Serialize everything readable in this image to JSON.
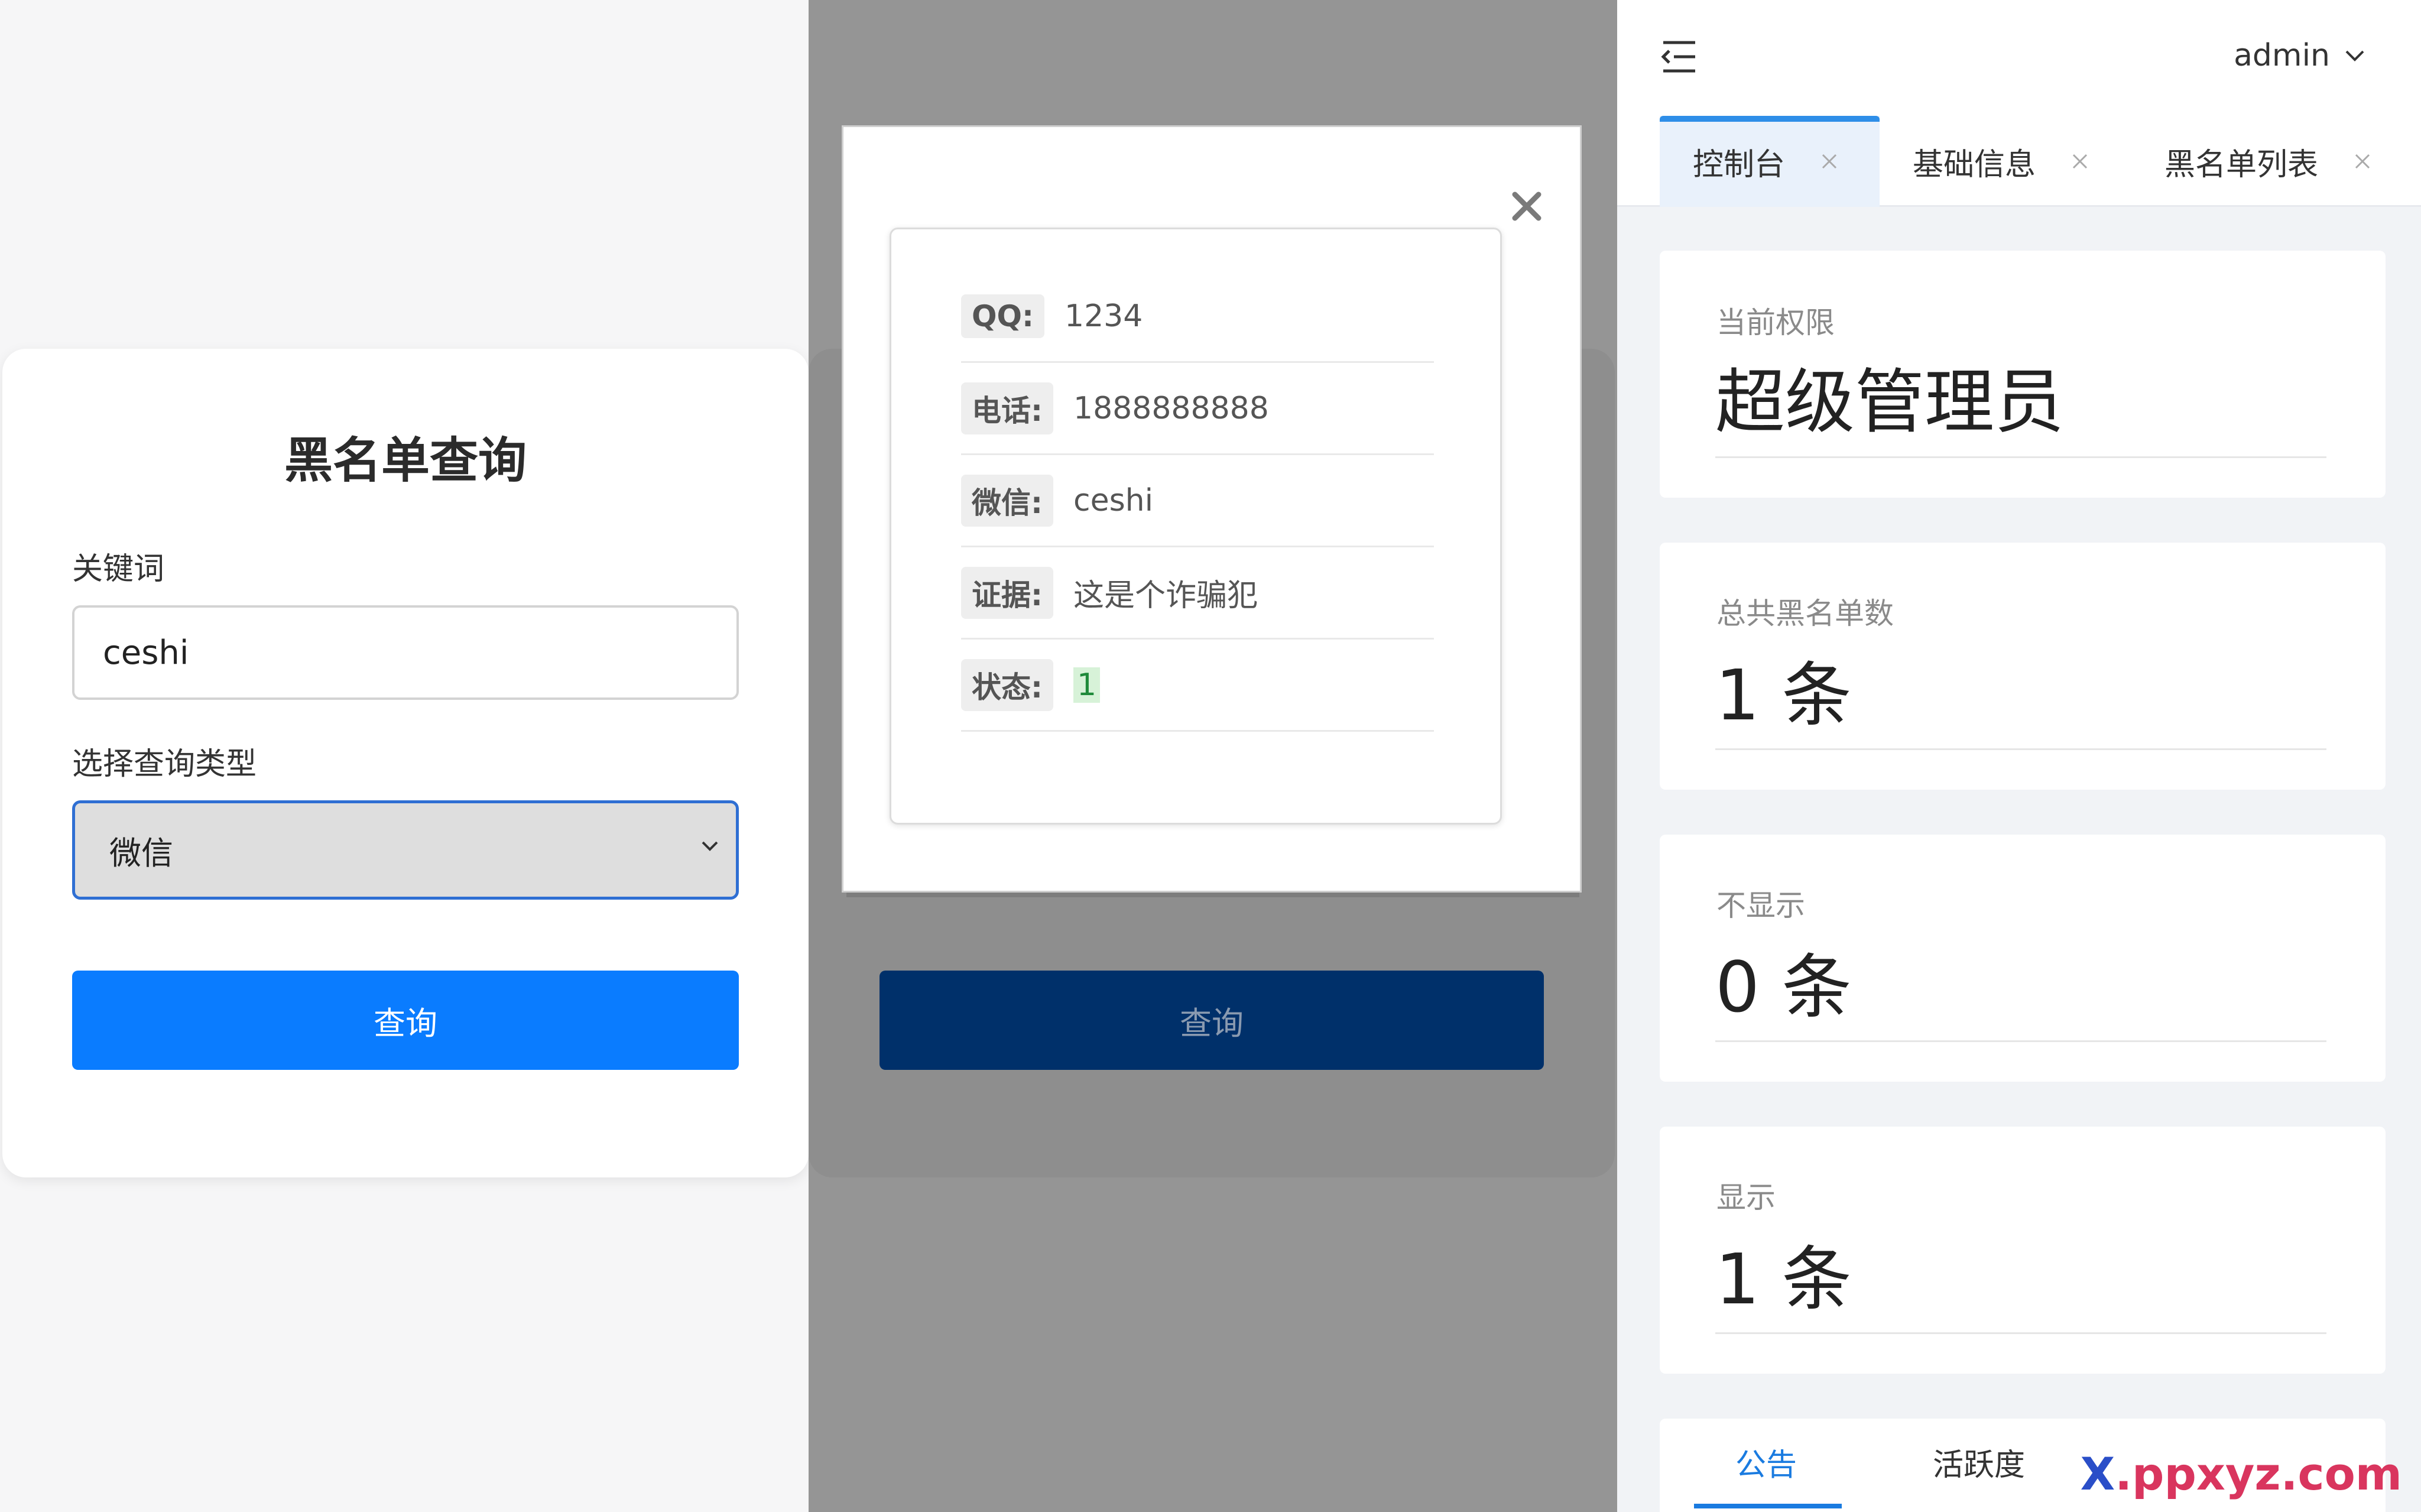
{
  "query_form": {
    "title": "黑名单查询",
    "keyword_label": "关键词",
    "keyword_value": "ceshi",
    "type_label": "选择查询类型",
    "type_selected": "微信",
    "submit_label": "查询"
  },
  "result_modal": {
    "rows": [
      {
        "label": "QQ:",
        "value": "1234"
      },
      {
        "label": "电话:",
        "value": "1888888888"
      },
      {
        "label": "微信:",
        "value": "ceshi"
      },
      {
        "label": "证据:",
        "value": "这是个诈骗犯"
      },
      {
        "label": "状态:",
        "value": "1"
      }
    ],
    "behind_button_label": "查询"
  },
  "dashboard": {
    "user": "admin",
    "tabs": [
      {
        "label": "控制台"
      },
      {
        "label": "基础信息"
      },
      {
        "label": "黑名单列表"
      }
    ],
    "stats": [
      {
        "label": "当前权限",
        "value": "超级管理员"
      },
      {
        "label": "总共黑名单数",
        "value": "1 条"
      },
      {
        "label": "不显示",
        "value": "0 条"
      },
      {
        "label": "显示",
        "value": "1 条"
      }
    ],
    "bottom_tabs": [
      {
        "label": "公告"
      },
      {
        "label": "活跃度"
      }
    ]
  },
  "watermark": {
    "x": "X",
    "rest": ".ppxyz.com"
  },
  "colors": {
    "primary": "#0a7cff",
    "dark_button": "#00306a",
    "tab_accent": "#2e8ee8",
    "link_blue": "#1a7be0"
  }
}
